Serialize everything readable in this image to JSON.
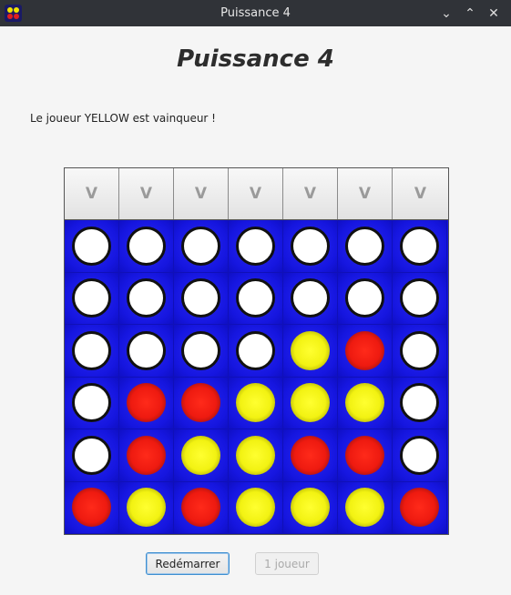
{
  "window": {
    "title": "Puissance 4",
    "controls": [
      "minimize",
      "maximize",
      "close"
    ]
  },
  "game": {
    "title": "Puissance 4",
    "status": "Le joueur YELLOW est vainqueur !"
  },
  "drop_buttons": [
    "V",
    "V",
    "V",
    "V",
    "V",
    "V",
    "V"
  ],
  "board": [
    [
      "white",
      "white",
      "white",
      "white",
      "white",
      "white",
      "white"
    ],
    [
      "white",
      "white",
      "white",
      "white",
      "white",
      "white",
      "white"
    ],
    [
      "white",
      "white",
      "white",
      "white",
      "yellow",
      "red",
      "white"
    ],
    [
      "white",
      "red",
      "red",
      "yellow",
      "yellow",
      "yellow",
      "white"
    ],
    [
      "white",
      "red",
      "yellow",
      "yellow",
      "red",
      "red",
      "white"
    ],
    [
      "red",
      "yellow",
      "red",
      "yellow",
      "yellow",
      "yellow",
      "red"
    ]
  ],
  "buttons": {
    "restart": "Redémarrer",
    "one_player": "1 joueur"
  },
  "colors": {
    "board": "#1414e6",
    "red": "#ee1a10",
    "yellow": "#f2f212",
    "empty": "#ffffff"
  }
}
